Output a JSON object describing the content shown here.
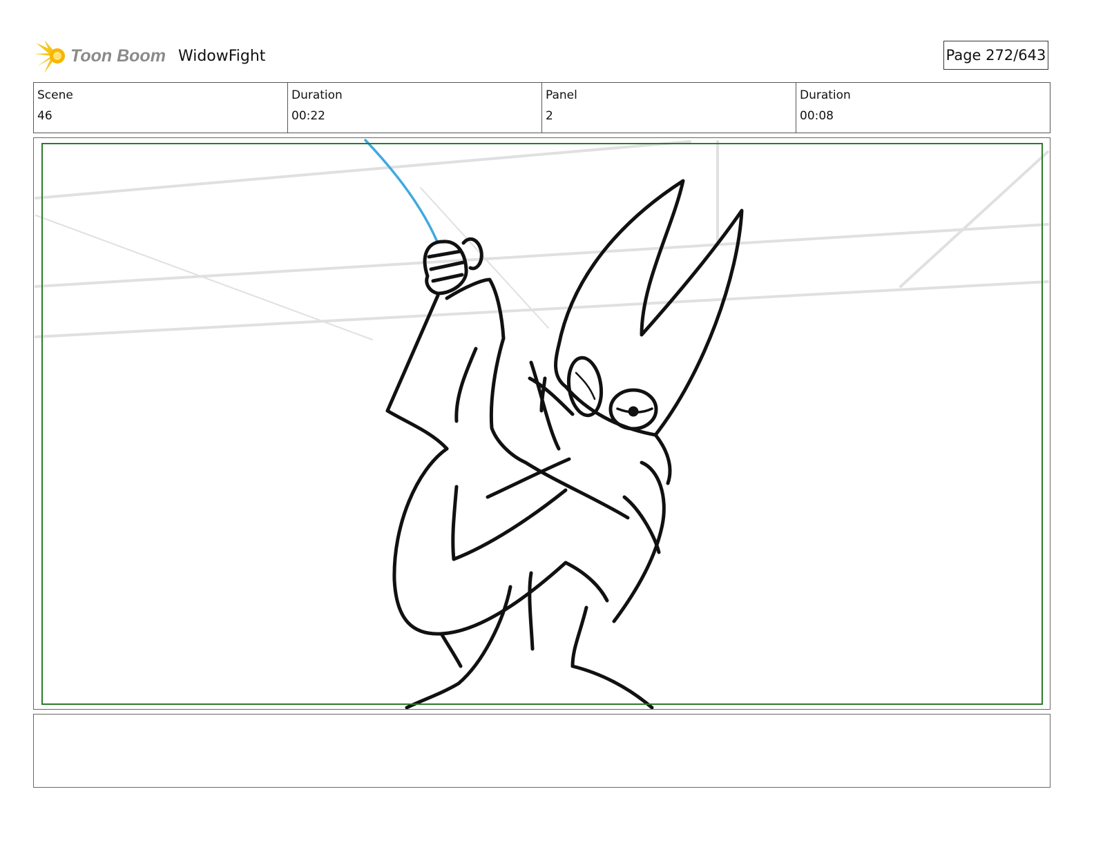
{
  "header": {
    "logo_text": "Toon Boom",
    "project_title": "WidowFight",
    "page_label": "Page 272/643"
  },
  "info": [
    {
      "label": "Scene",
      "value": "46"
    },
    {
      "label": "Duration",
      "value": "00:22"
    },
    {
      "label": "Panel",
      "value": "2"
    },
    {
      "label": "Duration",
      "value": "00:08"
    }
  ],
  "notes": {
    "text": ""
  },
  "colors": {
    "frame_green": "#2a7a2a",
    "wire_blue": "#3fa9e0",
    "logo_yellow": "#f5c518",
    "background_lines": "#e0e0e0"
  },
  "icons": {
    "logo": "toon-boom-burst-icon"
  }
}
